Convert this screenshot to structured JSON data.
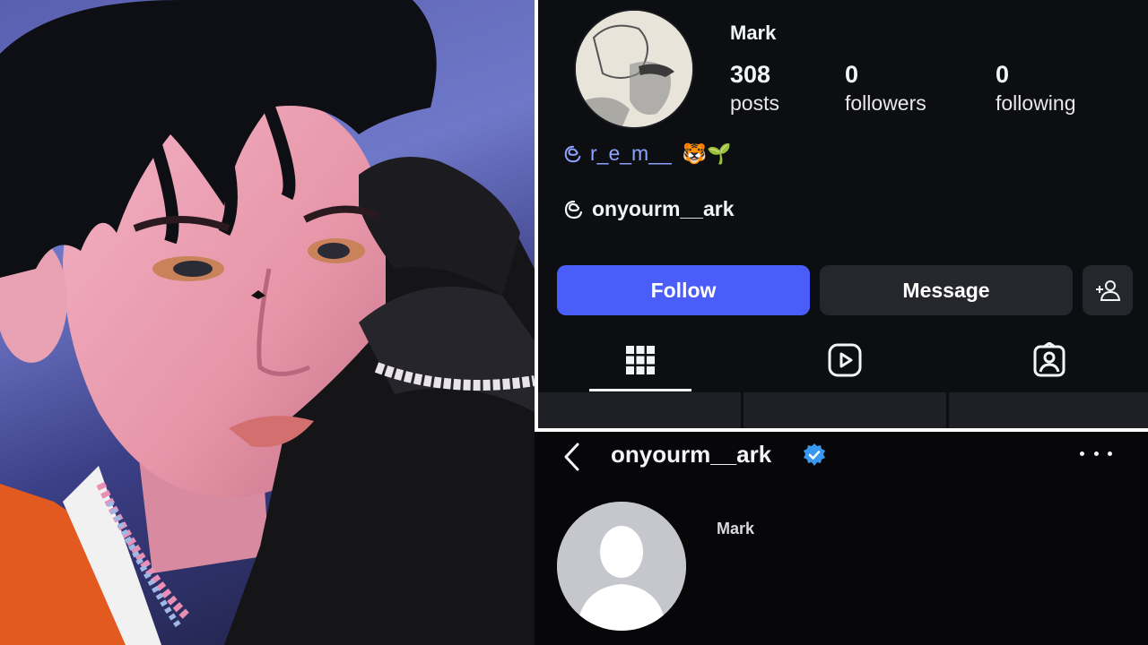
{
  "top_profile": {
    "display_name": "Mark",
    "stats": [
      {
        "value": "308",
        "label": "posts"
      },
      {
        "value": "0",
        "label": "followers"
      },
      {
        "value": "0",
        "label": "following"
      }
    ],
    "threads_mention": "r_e_m__",
    "threads_mention_emoji": "🐯🌱",
    "threads_link": "onyourm__ark",
    "buttons": {
      "follow": "Follow",
      "message": "Message"
    },
    "tabs": [
      "grid-icon",
      "reels-icon",
      "tagged-icon"
    ]
  },
  "bottom_profile": {
    "username": "onyourm__ark",
    "display_name": "Mark"
  },
  "colors": {
    "follow_button": "#4a5df9",
    "panel_bg": "#0d0e12",
    "mention": "#8ea3ff",
    "verified": "#3897f0"
  }
}
